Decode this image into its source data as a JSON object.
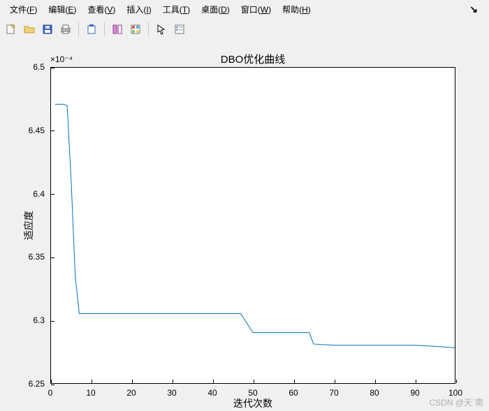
{
  "menu": {
    "items": [
      {
        "label": "文件",
        "key": "F"
      },
      {
        "label": "编辑",
        "key": "E"
      },
      {
        "label": "查看",
        "key": "V"
      },
      {
        "label": "插入",
        "key": "I"
      },
      {
        "label": "工具",
        "key": "T"
      },
      {
        "label": "桌面",
        "key": "D"
      },
      {
        "label": "窗口",
        "key": "W"
      },
      {
        "label": "帮助",
        "key": "H"
      }
    ]
  },
  "toolbar": {
    "icons": [
      "new-figure",
      "open",
      "save",
      "print",
      "|",
      "clipboard",
      "|",
      "data-cursor",
      "colorbar",
      "|",
      "pointer",
      "legend"
    ]
  },
  "watermark": "CSDN @天`南",
  "chart_data": {
    "type": "line",
    "title": "DBO优化曲线",
    "xlabel": "迭代次数",
    "ylabel": "适应度",
    "y_exponent_label": "×10⁻⁴",
    "xlim": [
      0,
      100
    ],
    "ylim": [
      6.25,
      6.5
    ],
    "xticks": [
      0,
      10,
      20,
      30,
      40,
      50,
      60,
      70,
      80,
      90,
      100
    ],
    "yticks": [
      6.25,
      6.3,
      6.35,
      6.4,
      6.45,
      6.5
    ],
    "x": [
      1,
      2,
      3,
      4,
      5,
      6,
      7,
      10,
      20,
      30,
      40,
      47,
      48,
      50,
      55,
      60,
      64,
      65,
      70,
      80,
      90,
      96,
      100
    ],
    "values": [
      6.471,
      6.471,
      6.471,
      6.47,
      6.41,
      6.335,
      6.305,
      6.305,
      6.305,
      6.305,
      6.305,
      6.305,
      6.3,
      6.29,
      6.29,
      6.29,
      6.29,
      6.281,
      6.28,
      6.28,
      6.28,
      6.279,
      6.278
    ],
    "y_scale_note": "values are ×10^-4"
  }
}
